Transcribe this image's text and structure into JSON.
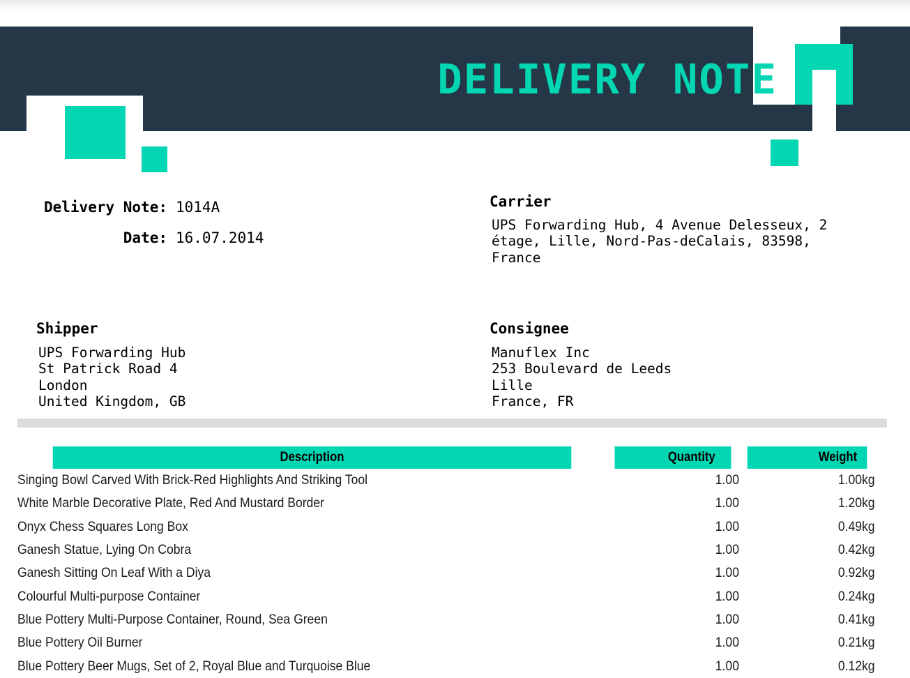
{
  "colors": {
    "navy": "#253746",
    "teal": "#03d6b2",
    "divider_gray": "#dcdcdc",
    "text_black": "#000000"
  },
  "header": {
    "title": "DELIVERY NOTE"
  },
  "meta": {
    "delivery_note_label": "Delivery Note:",
    "delivery_note_value": "1014A",
    "date_label": "Date:",
    "date_value": "16.07.2014"
  },
  "carrier": {
    "heading": "Carrier",
    "address": "UPS Forwarding Hub, 4 Avenue Delesseux, 2 étage, Lille, Nord-Pas-deCalais, 83598, France"
  },
  "shipper": {
    "heading": "Shipper",
    "lines": [
      "UPS Forwarding Hub",
      "St Patrick Road 4",
      "London",
      "United Kingdom, GB"
    ]
  },
  "consignee": {
    "heading": "Consignee",
    "lines": [
      "Manuflex Inc",
      "253 Boulevard de Leeds",
      "Lille",
      "France, FR"
    ]
  },
  "items_table": {
    "columns": [
      "Description",
      "Quantity",
      "Weight"
    ],
    "rows": [
      {
        "description": "Singing Bowl Carved With Brick-Red Highlights And Striking Tool",
        "quantity": "1.00",
        "weight": "1.00kg"
      },
      {
        "description": "White Marble Decorative Plate, Red And Mustard Border",
        "quantity": "1.00",
        "weight": "1.20kg"
      },
      {
        "description": "Onyx Chess Squares Long Box",
        "quantity": "1.00",
        "weight": "0.49kg"
      },
      {
        "description": "Ganesh Statue, Lying On Cobra",
        "quantity": "1.00",
        "weight": "0.42kg"
      },
      {
        "description": "Ganesh Sitting On Leaf With a Diya",
        "quantity": "1.00",
        "weight": "0.92kg"
      },
      {
        "description": "Colourful Multi-purpose Container",
        "quantity": "1.00",
        "weight": "0.24kg"
      },
      {
        "description": "Blue Pottery Multi-Purpose Container, Round, Sea Green",
        "quantity": "1.00",
        "weight": "0.41kg"
      },
      {
        "description": "Blue Pottery Oil Burner",
        "quantity": "1.00",
        "weight": "0.21kg"
      },
      {
        "description": "Blue Pottery Beer Mugs, Set of 2, Royal Blue and Turquoise Blue",
        "quantity": "1.00",
        "weight": "0.12kg"
      }
    ]
  }
}
